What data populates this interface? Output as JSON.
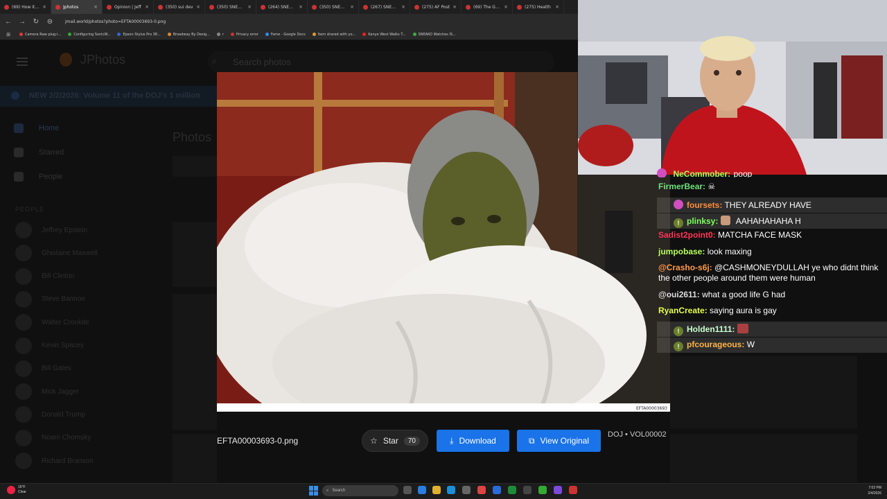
{
  "browser": {
    "tabs": [
      {
        "label": "(69) How it fe"
      },
      {
        "label": "Jphotos"
      },
      {
        "label": "Opinion | Jeff"
      },
      {
        "label": "(350) sui dev"
      },
      {
        "label": "(350) SNEAKO"
      },
      {
        "label": "(264) SNEAKO"
      },
      {
        "label": "(350) SNEAKO"
      },
      {
        "label": "(267) SNEAKO"
      },
      {
        "label": "(275) AF Post"
      },
      {
        "label": "(69) The Gran"
      },
      {
        "label": "(275) Health"
      }
    ],
    "url": "jmail.world/photos?photo=EFTA00003693-0.png",
    "bookmarks": [
      {
        "label": "Camera Raw plug-i...",
        "color": "#e33"
      },
      {
        "label": "Configuring SonicW...",
        "color": "#3a3"
      },
      {
        "label": "Epson Stylus Pro 38...",
        "color": "#36c"
      },
      {
        "label": "Broadway By Desig...",
        "color": "#d83"
      },
      {
        "label": "r",
        "color": "#888"
      },
      {
        "label": "Privacy error",
        "color": "#c33"
      },
      {
        "label": "Fame - Google Docs",
        "color": "#38e"
      },
      {
        "label": "Item shared with yo...",
        "color": "#d93"
      },
      {
        "label": "Kanye West Walks T...",
        "color": "#e22"
      },
      {
        "label": "SNEAKO Watches IS...",
        "color": "#4a4"
      }
    ]
  },
  "app": {
    "title": "JPhotos",
    "search_placeholder": "Search photos",
    "banner": "NEW 2/2/2026: Volume 11 of the DOJ's 1 million",
    "nav": [
      {
        "label": "Home"
      },
      {
        "label": "Starred"
      },
      {
        "label": "People"
      }
    ],
    "people_heading": "PEOPLE",
    "people": [
      "Jeffrey Epstein",
      "Ghislaine Maxwell",
      "Bill Clinton",
      "Steve Bannon",
      "Walter Cronkite",
      "Kevin Spacey",
      "Bill Gates",
      "Mick Jagger",
      "Donald Trump",
      "Noam Chomsky",
      "Richard Branson"
    ],
    "photos_title": "Photos"
  },
  "viewer": {
    "photo_id_caption": "EFTA00003693",
    "filename": "EFTA00003693-0.png",
    "star_label": "Star",
    "star_count": "70",
    "download_label": "Download",
    "view_original_label": "View Original",
    "meta": "DOJ • VOL00002"
  },
  "chat": {
    "messages": [
      {
        "user": "FirmerBear:",
        "text": "",
        "color": "#6ee07a",
        "badge": "",
        "emote": "skull",
        "hl": false
      },
      {
        "user": "foursets:",
        "text": "THEY ALREADY HAVE",
        "color": "#ff8c3a",
        "badge": "pink",
        "hl": true
      },
      {
        "user": "plinksy:",
        "text": "AAHAHAHAHA H",
        "color": "#7cff5a",
        "badge": "exclaim",
        "emote": "face",
        "hl": true
      },
      {
        "user": "Sadist2point0:",
        "text": "MATCHA FACE MASK",
        "color": "#ff3355",
        "badge": "",
        "hl": false
      },
      {
        "user": "jumpobase:",
        "text": "look maxing",
        "color": "#b7ff5a",
        "badge": "",
        "hl": false
      },
      {
        "user": "@Crasho-s6j:",
        "text": "@CASHMONEYDULLAH ye who didnt think the other people around them were human",
        "color": "#ff9a4a",
        "badge": "",
        "hl": false
      },
      {
        "user": "@oui2611:",
        "text": "what a good life G had",
        "color": "#dddddd",
        "badge": "",
        "hl": false
      },
      {
        "user": "RyanCreate:",
        "text": "saying aura is gay",
        "color": "#e6ff4a",
        "badge": "",
        "hl": false
      },
      {
        "user": "Holden1111:",
        "text": "",
        "color": "#c9ffd0",
        "badge": "exclaim",
        "emote": "box",
        "hl": true
      },
      {
        "user": "pfcourageous:",
        "text": "W",
        "color": "#ffb347",
        "badge": "exclaim",
        "hl": true
      }
    ],
    "partial_top": {
      "user": "NeCommober:",
      "text": "poop",
      "color": "#a9ff5a"
    }
  },
  "taskbar": {
    "weather_temp": "16°F",
    "weather_desc": "Clear",
    "search_label": "Search",
    "time": "7:02 PM",
    "date": "2/4/2026"
  },
  "colors": {
    "accent": "#1a73e8"
  }
}
